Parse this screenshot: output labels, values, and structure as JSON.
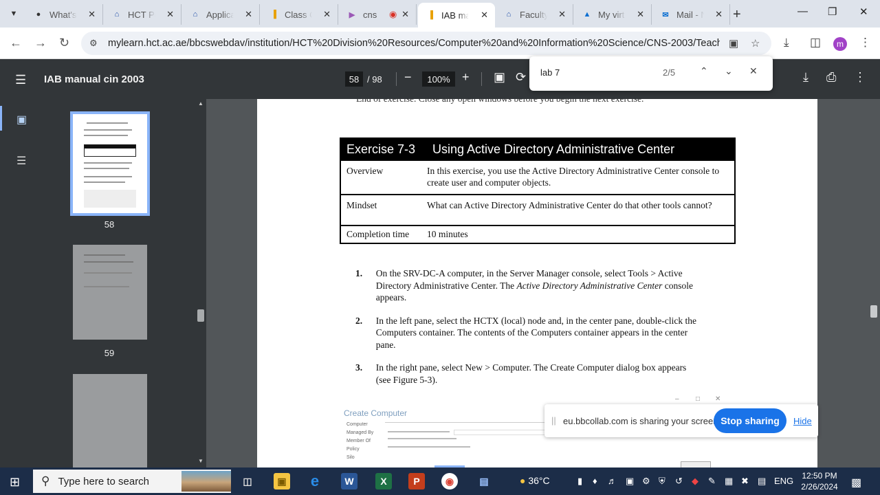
{
  "browser": {
    "tabs": [
      {
        "title": "What's I",
        "icon": "github-icon",
        "fav": "●",
        "color": "#333"
      },
      {
        "title": "HCT Po",
        "icon": "blackboard-icon",
        "fav": "⌂",
        "color": "#1a4aa8"
      },
      {
        "title": "Applican",
        "icon": "blackboard-icon",
        "fav": "⌂",
        "color": "#1a4aa8"
      },
      {
        "title": "Class Cr",
        "icon": "bar-chart-icon",
        "fav": "▐",
        "color": "#e8a000"
      },
      {
        "title": "cns",
        "icon": "recording-icon",
        "fav": "▶",
        "color": "#9b59b6"
      },
      {
        "title": "IAB mar",
        "icon": "bar-chart-icon",
        "fav": "▐",
        "color": "#e8a000"
      },
      {
        "title": "Faculty",
        "icon": "blackboard-icon",
        "fav": "⌂",
        "color": "#1a4aa8"
      },
      {
        "title": "My virt",
        "icon": "azure-icon",
        "fav": "▲",
        "color": "#0a6ed1"
      },
      {
        "title": "Mail - N",
        "icon": "outlook-icon",
        "fav": "✉",
        "color": "#0a6ed1"
      }
    ],
    "url": "mylearn.hct.ac.ae/bbcswebdav/institution/HCT%20Division%20Resources/Computer%20and%20Information%20Science/CNS-2003/Teaching%...",
    "profile_initial": "m"
  },
  "viewer": {
    "title": "IAB manual cin 2003",
    "current_page": "58",
    "total_pages": "/ 98",
    "zoom": "100%"
  },
  "find": {
    "query": "lab 7",
    "count": "2/5"
  },
  "thumbnails": [
    {
      "label": "58"
    },
    {
      "label": "59"
    }
  ],
  "document": {
    "cut_line": "End of exercise. Close any open windows before you begin the next exercise.",
    "exercise": {
      "number": "Exercise 7-3",
      "title": "Using Active Directory Administrative Center",
      "rows": [
        {
          "key": "Overview",
          "value": "In this exercise, you use the Active Directory Administrative Center console to create user and computer objects."
        },
        {
          "key": "Mindset",
          "value": "What can Active Directory Administrative Center do that other tools cannot?"
        },
        {
          "key": "Completion time",
          "value": "10 minutes"
        }
      ]
    },
    "steps": [
      {
        "num": "1.",
        "text_a": "On the SRV-DC-A computer, in the Server Manager console, select Tools > Active Directory Administrative Center. The ",
        "text_em": "Active Directory Administrative Center",
        "text_b": " console appears."
      },
      {
        "num": "2.",
        "text_a": "In the left pane, select the HCTX (local) node and, in the center pane, double-click the Computers container. The contents of the Computers container appears in the center pane.",
        "text_em": "",
        "text_b": ""
      },
      {
        "num": "3.",
        "text_a": "In the right pane, select New > Computer. The Create Computer dialog box appears (see Figure 5-3).",
        "text_em": "",
        "text_b": ""
      }
    ],
    "figure": {
      "title": "Create Computer",
      "labels": [
        "Computer",
        "Managed By",
        "Member Of",
        "Policy",
        "Silo"
      ]
    }
  },
  "share_banner": {
    "message": "eu.bbcollab.com is sharing your screen.",
    "stop_label": "Stop sharing",
    "hide_label": "Hide"
  },
  "taskbar": {
    "search_placeholder": "Type here to search",
    "temperature": "36°C",
    "language": "ENG",
    "time": "12:50 PM",
    "date": "2/26/2024"
  }
}
